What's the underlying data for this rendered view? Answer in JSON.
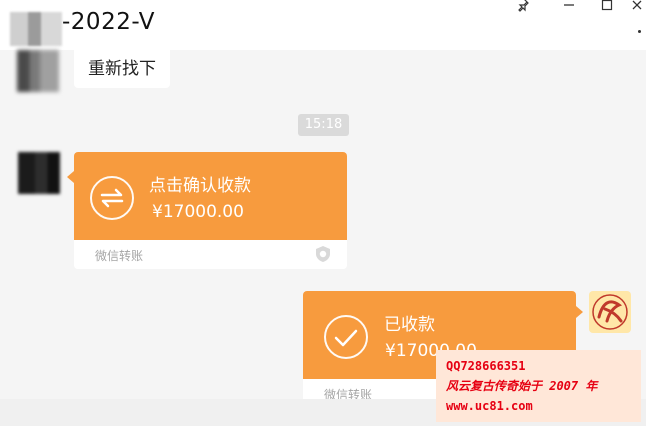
{
  "window": {
    "title": "-2022-V"
  },
  "messages": {
    "top_text": "重新找下",
    "timestamp": "15:18",
    "transfer_received": {
      "title": "点击确认收款",
      "amount": "¥17000.00",
      "footer": "微信转账"
    },
    "transfer_sent": {
      "title": "已收款",
      "amount": "¥17000.00",
      "footer": "微信转账"
    }
  },
  "watermark": {
    "line1": "QQ728666351",
    "line2": "风云复古传奇始于 2007 年",
    "line3": "www.uc81.com"
  },
  "colors": {
    "accent": "#f79b3e",
    "background": "#f5f5f5",
    "watermark_text": "#e60012"
  }
}
